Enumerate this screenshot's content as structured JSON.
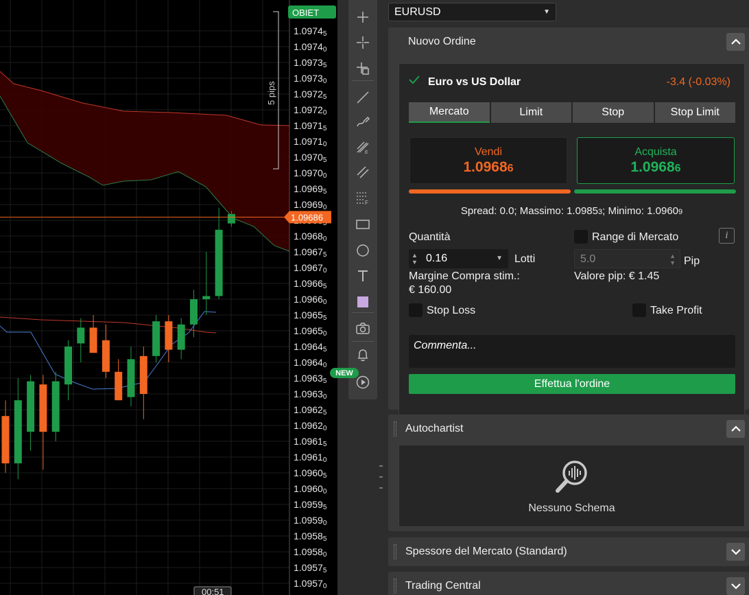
{
  "chart": {
    "price_labels": [
      {
        "main": "1.0974",
        "sub": "5"
      },
      {
        "main": "1.0974",
        "sub": "0"
      },
      {
        "main": "1.0973",
        "sub": "5"
      },
      {
        "main": "1.0973",
        "sub": "0"
      },
      {
        "main": "1.0972",
        "sub": "5"
      },
      {
        "main": "1.0972",
        "sub": "0"
      },
      {
        "main": "1.0971",
        "sub": "5"
      },
      {
        "main": "1.0971",
        "sub": "0"
      },
      {
        "main": "1.0970",
        "sub": "5"
      },
      {
        "main": "1.0970",
        "sub": "0"
      },
      {
        "main": "1.0969",
        "sub": "5"
      },
      {
        "main": "1.0969",
        "sub": "0"
      },
      {
        "main": "1.0968",
        "sub": "5"
      },
      {
        "main": "1.0968",
        "sub": "0"
      },
      {
        "main": "1.0967",
        "sub": "5"
      },
      {
        "main": "1.0967",
        "sub": "0"
      },
      {
        "main": "1.0966",
        "sub": "5"
      },
      {
        "main": "1.0966",
        "sub": "0"
      },
      {
        "main": "1.0965",
        "sub": "5"
      },
      {
        "main": "1.0965",
        "sub": "0"
      },
      {
        "main": "1.0964",
        "sub": "5"
      },
      {
        "main": "1.0964",
        "sub": "0"
      },
      {
        "main": "1.0963",
        "sub": "5"
      },
      {
        "main": "1.0963",
        "sub": "0"
      },
      {
        "main": "1.0962",
        "sub": "5"
      },
      {
        "main": "1.0962",
        "sub": "0"
      },
      {
        "main": "1.0961",
        "sub": "5"
      },
      {
        "main": "1.0961",
        "sub": "0"
      },
      {
        "main": "1.0960",
        "sub": "5"
      },
      {
        "main": "1.0960",
        "sub": "0"
      },
      {
        "main": "1.0959",
        "sub": "5"
      },
      {
        "main": "1.0959",
        "sub": "0"
      },
      {
        "main": "1.0958",
        "sub": "5"
      },
      {
        "main": "1.0958",
        "sub": "0"
      },
      {
        "main": "1.0957",
        "sub": "5"
      },
      {
        "main": "1.0957",
        "sub": "0"
      }
    ],
    "current_price": "1.09686",
    "target_tag": "OBIET",
    "range_label": "5 pips",
    "countdown": "00:51",
    "colors": {
      "bull": "#1e9c4a",
      "bear": "#f26722",
      "cloud": "#3a0000",
      "cloud_edge": "#c0392b",
      "tenkan": "#4a7fd4"
    },
    "candles": [
      {
        "o": 1.09623,
        "h": 1.09628,
        "l": 1.09605,
        "c": 1.09608
      },
      {
        "o": 1.09608,
        "h": 1.09635,
        "l": 1.09603,
        "c": 1.09628
      },
      {
        "o": 1.09618,
        "h": 1.09636,
        "l": 1.09612,
        "c": 1.09634
      },
      {
        "o": 1.09633,
        "h": 1.09636,
        "l": 1.09606,
        "c": 1.09618
      },
      {
        "o": 1.09618,
        "h": 1.09637,
        "l": 1.09615,
        "c": 1.09634
      },
      {
        "o": 1.09633,
        "h": 1.09647,
        "l": 1.09628,
        "c": 1.09645
      },
      {
        "o": 1.09646,
        "h": 1.09654,
        "l": 1.0964,
        "c": 1.09651
      },
      {
        "o": 1.09651,
        "h": 1.09655,
        "l": 1.09643,
        "c": 1.09643
      },
      {
        "o": 1.09647,
        "h": 1.09652,
        "l": 1.09635,
        "c": 1.09637
      },
      {
        "o": 1.09637,
        "h": 1.09641,
        "l": 1.09628,
        "c": 1.09628
      },
      {
        "o": 1.09629,
        "h": 1.09645,
        "l": 1.09626,
        "c": 1.09641
      },
      {
        "o": 1.09642,
        "h": 1.09645,
        "l": 1.09622,
        "c": 1.0963
      },
      {
        "o": 1.09642,
        "h": 1.09655,
        "l": 1.0964,
        "c": 1.09653
      },
      {
        "o": 1.09653,
        "h": 1.09655,
        "l": 1.0964,
        "c": 1.09644
      },
      {
        "o": 1.09644,
        "h": 1.09654,
        "l": 1.09641,
        "c": 1.09652
      },
      {
        "o": 1.09652,
        "h": 1.09663,
        "l": 1.09648,
        "c": 1.0966
      },
      {
        "o": 1.0966,
        "h": 1.09675,
        "l": 1.09655,
        "c": 1.09661
      },
      {
        "o": 1.09661,
        "h": 1.09689,
        "l": 1.0966,
        "c": 1.09682
      },
      {
        "o": 1.09684,
        "h": 1.09688,
        "l": 1.09683,
        "c": 1.09687
      }
    ]
  },
  "toolbar": {
    "new_badge": "NEW",
    "tools": [
      "crosshair-icon",
      "center-cross-icon",
      "cursor-cross-icon",
      "trend-line-icon",
      "freehand-icon",
      "fibonacci-icon",
      "parallel-channel-icon",
      "fibonacci-grid-icon",
      "rectangle-icon",
      "circle-icon",
      "text-tool-icon",
      "color-swatch-icon",
      "camera-icon",
      "bell-icon",
      "replay-icon"
    ]
  },
  "panel": {
    "symbol": "EURUSD",
    "new_order": {
      "title": "Nuovo Ordine",
      "instrument": "Euro vs US Dollar",
      "change": "-3.4 (-0.03%)",
      "tabs": [
        "Mercato",
        "Limit",
        "Stop",
        "Stop Limit"
      ],
      "active_tab": "Mercato",
      "sell_label": "Vendi",
      "sell_price_main": "1.0968",
      "sell_price_pip": "6",
      "buy_label": "Acquista",
      "buy_price_main": "1.0968",
      "buy_price_pip": "6",
      "spread_a": "Spread: 0.0; Massimo: 1.0985",
      "spread_a_sub": "3",
      "spread_b": "; Minimo: 1.0960",
      "spread_b_sub": "9",
      "quantity_label": "Quantità",
      "quantity_value": "0.16",
      "lots_label": "Lotti",
      "market_range_label": "Range di Mercato",
      "info_label": "i",
      "pip_value": "5.0",
      "pip_label": "Pip",
      "margin_label": "Margine Compra stim.:",
      "margin_value": "€ 160.00",
      "pip_value_label": "Valore pip: € 1.45",
      "stop_loss_label": "Stop Loss",
      "take_profit_label": "Take Profit",
      "comment_placeholder": "Commenta...",
      "place_order_label": "Effettua l'ordine"
    },
    "autochartist": {
      "title": "Autochartist",
      "empty": "Nessuno Schema"
    },
    "market_depth": {
      "title": "Spessore del Mercato (Standard)"
    },
    "trading_central": {
      "title": "Trading Central"
    }
  }
}
